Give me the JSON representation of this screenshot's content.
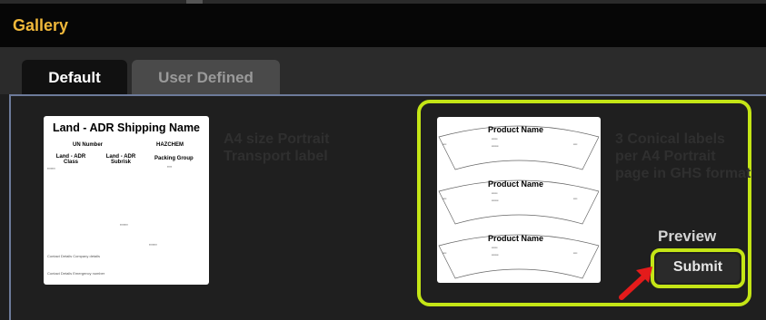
{
  "window": {
    "title": "Gallery"
  },
  "tabs": [
    {
      "label": "Default",
      "active": true
    },
    {
      "label": "User Defined",
      "active": false
    }
  ],
  "templates": [
    {
      "description": "A4 size Portrait Transport label",
      "preview": {
        "title": "Land - ADR Shipping Name",
        "un_number": "UN Number",
        "hazchem": "HAZCHEM",
        "class": "Land - ADR Class",
        "subrisk": "Land - ADR Subrisk",
        "packing_group": "Packing Group",
        "contact_company": "Contact Details Company details",
        "contact_emergency": "Contact Details Emergency number"
      }
    },
    {
      "description": "3 Conical labels per A4 Portrait page in GHS format",
      "preview": {
        "product_name": "Product Name",
        "product_name_count": 3
      },
      "selected": true
    }
  ],
  "actions": {
    "preview_label": "Preview",
    "submit_label": "Submit"
  },
  "colors": {
    "accent": "#f0b83a",
    "highlight": "#c4e516",
    "arrow": "#e41b1b"
  }
}
